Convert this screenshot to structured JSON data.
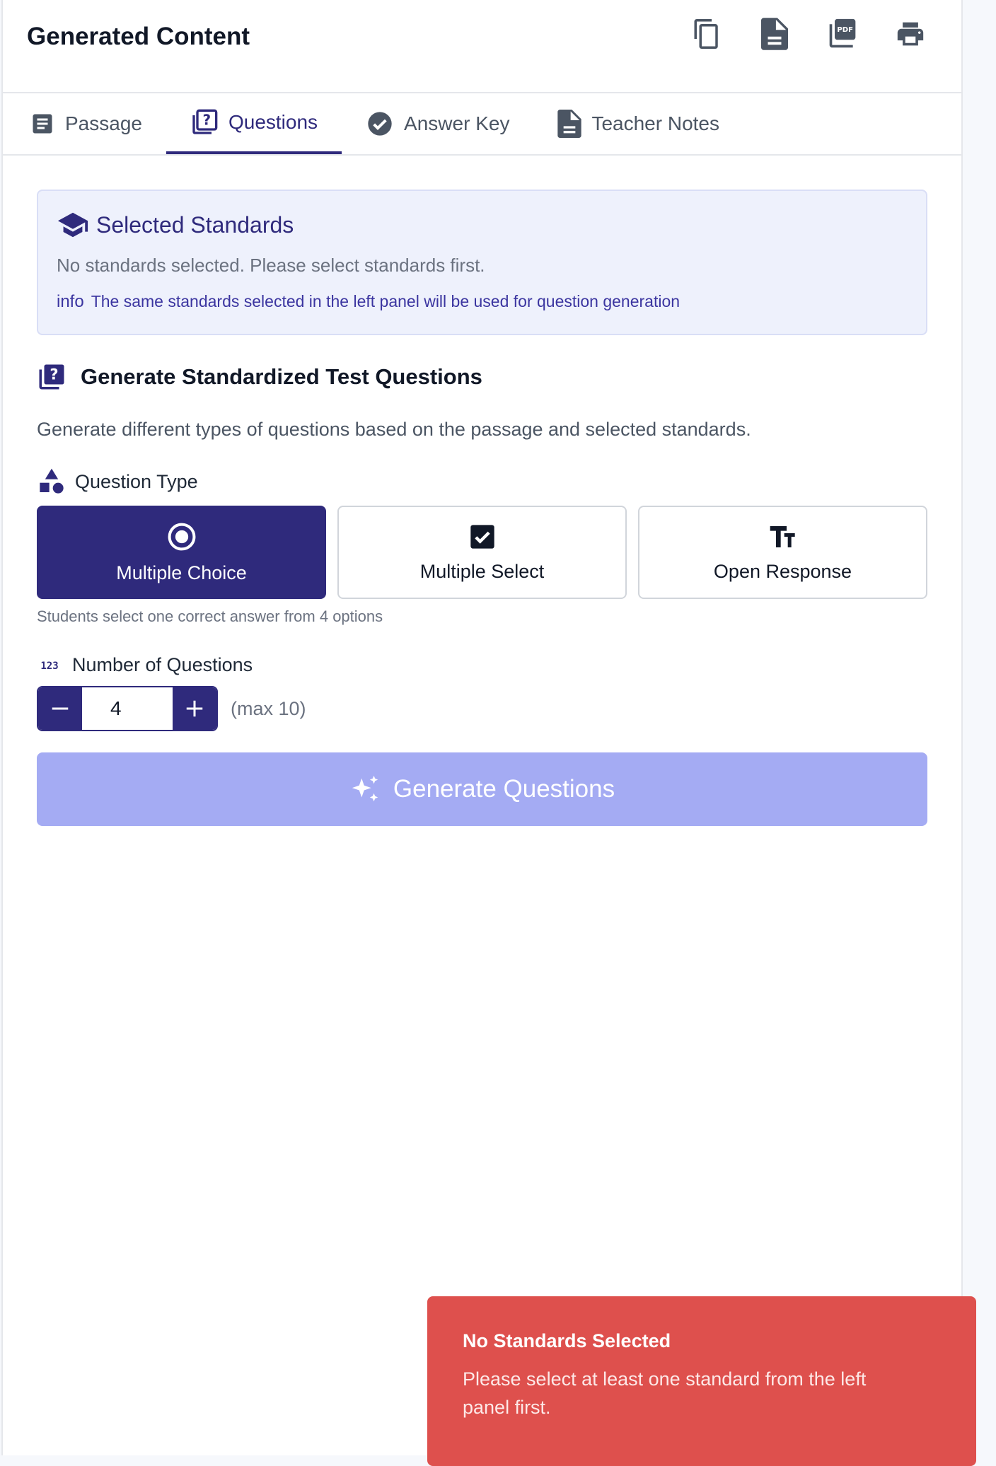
{
  "header": {
    "title": "Generated Content",
    "actions": [
      "copy-icon",
      "document-icon",
      "pdf-icon",
      "print-icon"
    ]
  },
  "tabs": [
    {
      "label": "Passage",
      "icon": "article-icon",
      "active": false
    },
    {
      "label": "Questions",
      "icon": "quiz-icon",
      "active": true
    },
    {
      "label": "Answer Key",
      "icon": "check-circle-icon",
      "active": false
    },
    {
      "label": "Teacher Notes",
      "icon": "description-icon",
      "active": false
    }
  ],
  "standards": {
    "title": "Selected Standards",
    "message": "No standards selected. Please select standards first.",
    "info_label": "info",
    "info_text": "The same standards selected in the left panel will be used for question generation"
  },
  "generate": {
    "title": "Generate Standardized Test Questions",
    "description": "Generate different types of questions based on the passage and selected standards.",
    "question_type_label": "Question Type",
    "question_types": [
      {
        "label": "Multiple Choice",
        "icon": "radio-checked-icon",
        "selected": true
      },
      {
        "label": "Multiple Select",
        "icon": "checkbox-checked-icon",
        "selected": false
      },
      {
        "label": "Open Response",
        "icon": "text-fields-icon",
        "selected": false
      }
    ],
    "question_type_hint": "Students select one correct answer from 4 options",
    "number_label": "Number of Questions",
    "number_value": "4",
    "number_max": "(max 10)",
    "button_label": "Generate Questions"
  },
  "toast": {
    "title": "No Standards Selected",
    "message": "Please select at least one standard from the left panel first."
  },
  "colors": {
    "primary": "#2f2a7c",
    "disabled_button": "#a4abf3",
    "standards_bg": "#eef1fc",
    "toast_bg": "#de504d"
  }
}
